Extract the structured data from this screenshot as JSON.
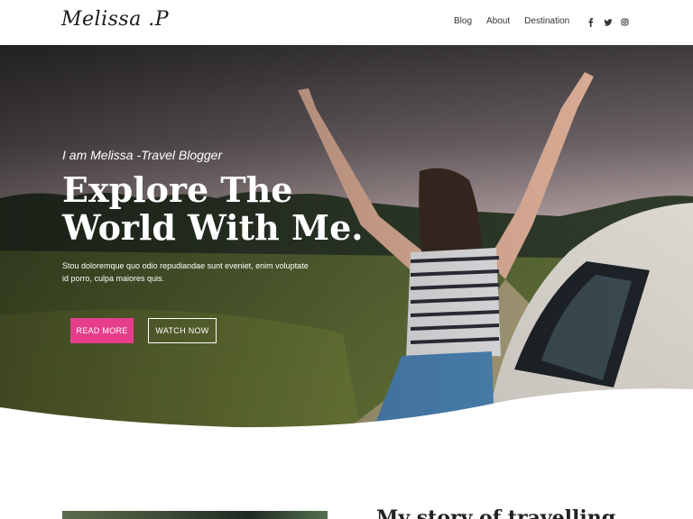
{
  "header": {
    "logo": "Melissa .P",
    "nav": [
      "Blog",
      "About",
      "Destination"
    ],
    "social_icons": [
      "facebook-icon",
      "twitter-icon",
      "instagram-icon"
    ]
  },
  "hero": {
    "subtitle": "I am Melissa -Travel Blogger",
    "title_line1": "Explore The",
    "title_line2": "World With Me.",
    "description": "Stou doloremque quo odio repudiandae sunt eveniet, enim voluptate id porro, culpa maiores quis.",
    "read_more": "READ MORE",
    "watch_now": "WATCH NOW"
  },
  "story": {
    "title": "My story of travelling"
  },
  "colors": {
    "accent": "#e63e8c",
    "header_bg": "#ffffff"
  }
}
